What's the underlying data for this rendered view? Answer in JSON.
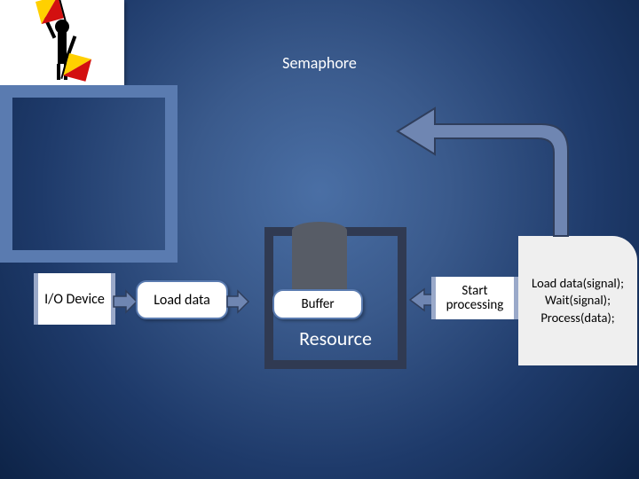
{
  "title": "Semaphore",
  "nodes": {
    "io": "I/O\nDevice",
    "load": "Load data",
    "buffer": "Buffer",
    "resource": "Resource",
    "start": "Start\nprocessing",
    "code": "Load data(signal);\nWait(signal);\nProcess(data);"
  },
  "colors": {
    "arrow_fill": "#6f86b2",
    "arrow_stroke": "#2f3e5c"
  }
}
